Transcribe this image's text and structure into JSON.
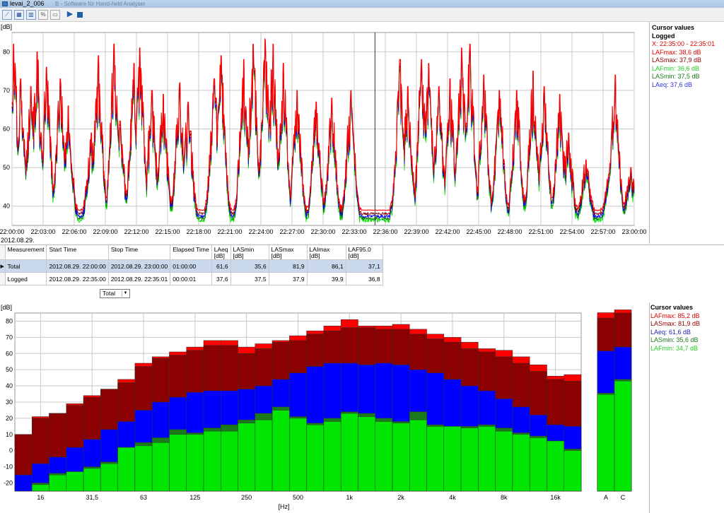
{
  "window": {
    "title": "levai_2_006",
    "title_ghost": "B - Software für Hand-held Analyser"
  },
  "toolbar": {
    "buttons": [
      {
        "name": "time-chart-button",
        "glyph": "⟋"
      },
      {
        "name": "overview-button",
        "glyph": "▦"
      },
      {
        "name": "spectrum-button",
        "glyph": "▥"
      },
      {
        "name": "statistics-button",
        "glyph": "%"
      },
      {
        "name": "report-button",
        "glyph": "▭"
      }
    ],
    "play_glyph": "▶",
    "stop_glyph": ""
  },
  "colors": {
    "lafmax": "#ff0000",
    "lasmax": "#8b0000",
    "laeq": "#0000ff",
    "lasmin": "#1a7a1a",
    "lafmin": "#00e600",
    "grid": "#c8c8c8",
    "cursor": "#333333"
  },
  "time_chart": {
    "unit_label": "[dB]",
    "date_label": "2012.08.29.",
    "cursor_time": "22:35:00"
  },
  "cursor_values_time": {
    "title": "Cursor values",
    "subtitle": "Logged",
    "lines": [
      {
        "text": "X: 22:35:00 - 22:35:01",
        "color": "#e00000"
      },
      {
        "text": "LAFmax: 38,6 dB",
        "color": "#e00000"
      },
      {
        "text": "LASmax: 37,9 dB",
        "color": "#8b0000"
      },
      {
        "text": "LAFmin: 36,6 dB",
        "color": "#22cc22"
      },
      {
        "text": "LASmin: 37,5 dB",
        "color": "#1a7a1a"
      },
      {
        "text": "LAeq: 37,6 dB",
        "color": "#3333cc"
      }
    ]
  },
  "table": {
    "headers": [
      [
        "Measurement",
        ""
      ],
      [
        "Start Time",
        ""
      ],
      [
        "Stop Time",
        ""
      ],
      [
        "Elapsed Time",
        ""
      ],
      [
        "LAeq",
        "[dB]"
      ],
      [
        "LASmin",
        "[dB]"
      ],
      [
        "LASmax",
        "[dB]"
      ],
      [
        "LAImax",
        "[dB]"
      ],
      [
        "LAF95.0",
        "[dB]"
      ]
    ],
    "rows": [
      [
        "Total",
        "2012.08.29. 22:00:00",
        "2012.08.29. 23:00:00",
        "01:00:00",
        "61,6",
        "35,6",
        "81,9",
        "86,1",
        "37,1"
      ],
      [
        "Logged",
        "2012.08.29. 22:35:00",
        "2012.08.29. 22:35:01",
        "00:00:01",
        "37,6",
        "37,5",
        "37,9",
        "39,9",
        "36,8"
      ]
    ],
    "selected_marker": "▶"
  },
  "dropdown": {
    "selected": "Total",
    "arrow": "▼"
  },
  "cursor_values_spectrum": {
    "title": "Cursor values",
    "lines": [
      {
        "text": "LAFmax: 85,2 dB",
        "color": "#e00000"
      },
      {
        "text": "LASmax: 81,9 dB",
        "color": "#8b0000"
      },
      {
        "text": "LAeq: 61,6 dB",
        "color": "#2222aa"
      },
      {
        "text": "LASmin: 35,6 dB",
        "color": "#1a7a1a"
      },
      {
        "text": "LAFmin: 34,7 dB",
        "color": "#22cc22"
      }
    ]
  },
  "chart_data": [
    {
      "type": "line",
      "ylabel": "[dB]",
      "ylim": [
        35,
        85
      ],
      "yticks": [
        40,
        50,
        60,
        70,
        80
      ],
      "x_range": [
        "22:00:00",
        "23:00:00"
      ],
      "xticks": [
        "22:00:00",
        "22:03:00",
        "22:06:00",
        "22:09:00",
        "22:12:00",
        "22:15:00",
        "22:18:00",
        "22:21:00",
        "22:24:00",
        "22:27:00",
        "22:30:00",
        "22:33:00",
        "22:36:00",
        "22:39:00",
        "22:42:00",
        "22:45:00",
        "22:48:00",
        "22:51:00",
        "22:54:00",
        "22:57:00",
        "23:00:00"
      ],
      "grid": true,
      "legend": "right",
      "baseline_dB": 38,
      "peaks": [
        {
          "t": "22:00:10",
          "dB": 82
        },
        {
          "t": "22:00:50",
          "dB": 73
        },
        {
          "t": "22:01:50",
          "dB": 71
        },
        {
          "t": "22:02:25",
          "dB": 80
        },
        {
          "t": "22:03:20",
          "dB": 76
        },
        {
          "t": "22:04:40",
          "dB": 73
        },
        {
          "t": "22:05:25",
          "dB": 66
        },
        {
          "t": "22:07:40",
          "dB": 59
        },
        {
          "t": "22:08:20",
          "dB": 79
        },
        {
          "t": "22:09:50",
          "dB": 82
        },
        {
          "t": "22:10:25",
          "dB": 62
        },
        {
          "t": "22:11:45",
          "dB": 77
        },
        {
          "t": "22:12:20",
          "dB": 81
        },
        {
          "t": "22:13:30",
          "dB": 70
        },
        {
          "t": "22:14:35",
          "dB": 69
        },
        {
          "t": "22:16:10",
          "dB": 72
        },
        {
          "t": "22:17:00",
          "dB": 67
        },
        {
          "t": "22:19:30",
          "dB": 73
        },
        {
          "t": "22:20:10",
          "dB": 79
        },
        {
          "t": "22:22:20",
          "dB": 78
        },
        {
          "t": "22:23:15",
          "dB": 82
        },
        {
          "t": "22:24:25",
          "dB": 83
        },
        {
          "t": "22:25:10",
          "dB": 82
        },
        {
          "t": "22:26:10",
          "dB": 77
        },
        {
          "t": "22:27:30",
          "dB": 70
        },
        {
          "t": "22:29:20",
          "dB": 67
        },
        {
          "t": "22:30:50",
          "dB": 68
        },
        {
          "t": "22:32:40",
          "dB": 70
        },
        {
          "t": "22:37:25",
          "dB": 78
        },
        {
          "t": "22:38:10",
          "dB": 71
        },
        {
          "t": "22:39:30",
          "dB": 78
        },
        {
          "t": "22:40:10",
          "dB": 77
        },
        {
          "t": "22:41:10",
          "dB": 71
        },
        {
          "t": "22:42:15",
          "dB": 73
        },
        {
          "t": "22:43:20",
          "dB": 81
        },
        {
          "t": "22:44:10",
          "dB": 82
        },
        {
          "t": "22:45:30",
          "dB": 74
        },
        {
          "t": "22:47:00",
          "dB": 70
        },
        {
          "t": "22:48:40",
          "dB": 70
        },
        {
          "t": "22:50:15",
          "dB": 75
        },
        {
          "t": "22:51:20",
          "dB": 71
        },
        {
          "t": "22:52:50",
          "dB": 69
        },
        {
          "t": "22:53:40",
          "dB": 59
        },
        {
          "t": "22:55:20",
          "dB": 52
        },
        {
          "t": "22:57:40",
          "dB": 51
        },
        {
          "t": "22:58:10",
          "dB": 74
        },
        {
          "t": "22:59:40",
          "dB": 50
        }
      ],
      "series": [
        {
          "name": "LAFmax",
          "color": "#ff0000"
        },
        {
          "name": "LASmax",
          "color": "#8b0000"
        },
        {
          "name": "LAeq",
          "color": "#0000ff"
        },
        {
          "name": "LASmin",
          "color": "#1a7a1a"
        },
        {
          "name": "LAFmin",
          "color": "#00e600"
        }
      ]
    },
    {
      "type": "bar",
      "stacked": "overlay",
      "xlabel": "[Hz]",
      "ylabel": "[dB]",
      "ylim": [
        -25,
        85
      ],
      "yticks": [
        -20,
        -10,
        0,
        10,
        20,
        30,
        40,
        50,
        60,
        70,
        80
      ],
      "grid": true,
      "legend": "right",
      "tick_labels": [
        {
          "label": "16",
          "index": 1
        },
        {
          "label": "31,5",
          "index": 4
        },
        {
          "label": "63",
          "index": 7
        },
        {
          "label": "125",
          "index": 10
        },
        {
          "label": "250",
          "index": 13
        },
        {
          "label": "500",
          "index": 16
        },
        {
          "label": "1k",
          "index": 19
        },
        {
          "label": "2k",
          "index": 22
        },
        {
          "label": "4k",
          "index": 25
        },
        {
          "label": "8k",
          "index": 28
        },
        {
          "label": "16k",
          "index": 31
        }
      ],
      "categories": [
        "12.5",
        "16",
        "20",
        "25",
        "31.5",
        "40",
        "50",
        "63",
        "80",
        "100",
        "125",
        "160",
        "200",
        "250",
        "315",
        "400",
        "500",
        "630",
        "800",
        "1k",
        "1.25k",
        "1.6k",
        "2k",
        "2.5k",
        "3.15k",
        "4k",
        "5k",
        "6.3k",
        "8k",
        "10k",
        "12.5k",
        "16k",
        "20k"
      ],
      "series": [
        {
          "name": "LAFmax",
          "color": "#ff0000",
          "values": [
            10,
            21,
            23,
            29,
            34,
            38,
            44,
            54,
            58,
            61,
            64,
            68,
            68,
            64,
            66,
            68,
            71,
            74,
            77,
            81,
            77,
            77,
            78,
            75,
            72,
            70,
            67,
            63,
            62,
            58,
            53,
            46,
            47
          ]
        },
        {
          "name": "LASmax",
          "color": "#8b0000",
          "values": [
            10,
            20,
            23,
            28,
            33,
            38,
            42,
            52,
            57,
            59,
            62,
            65,
            65,
            60,
            63,
            67,
            68,
            72,
            74,
            76,
            76,
            75,
            75,
            72,
            69,
            67,
            63,
            61,
            58,
            54,
            49,
            44,
            43
          ]
        },
        {
          "name": "LAeq",
          "color": "#0000ff",
          "values": [
            -15,
            -8,
            -4,
            2,
            7,
            13,
            18,
            25,
            30,
            33,
            36,
            37,
            37,
            38,
            40,
            44,
            48,
            52,
            54,
            54,
            53,
            54,
            53,
            50,
            48,
            44,
            40,
            37,
            32,
            27,
            22,
            16,
            15
          ]
        },
        {
          "name": "LASmin",
          "color": "#1a7a1a",
          "values": [
            -25,
            -20,
            -14,
            -13,
            -10,
            -7,
            2,
            5,
            8,
            13,
            11,
            14,
            16,
            19,
            23,
            27,
            21,
            17,
            20,
            24,
            23,
            20,
            18,
            24,
            16,
            15,
            15,
            16,
            14,
            11,
            9,
            6,
            1
          ]
        },
        {
          "name": "LAFmin",
          "color": "#00e600",
          "values": [
            -25,
            -21,
            -15,
            -13,
            -11,
            -8,
            2,
            3,
            5,
            10,
            10,
            12,
            12,
            17,
            19,
            25,
            20,
            16,
            18,
            23,
            21,
            18,
            17,
            19,
            15,
            15,
            14,
            15,
            12,
            10,
            8,
            6,
            0
          ]
        }
      ],
      "totals": {
        "categories": [
          "A",
          "C"
        ],
        "LAFmax": [
          85.2,
          87
        ],
        "LASmax": [
          81.9,
          85
        ],
        "LAeq": [
          61.6,
          64
        ],
        "LASmin": [
          35.6,
          44
        ],
        "LAFmin": [
          34.7,
          43
        ]
      }
    }
  ]
}
